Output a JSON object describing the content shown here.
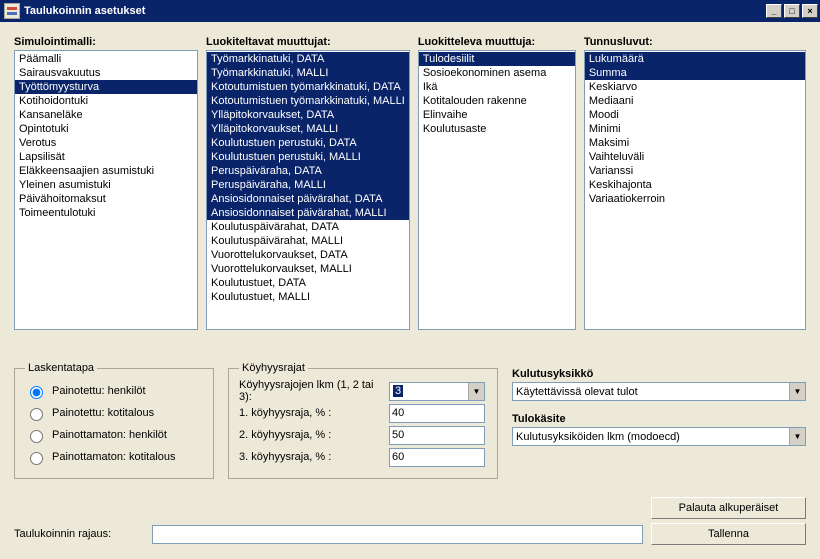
{
  "window": {
    "title": "Taulukoinnin asetukset"
  },
  "columns": {
    "simulointimalli": {
      "label": "Simulointimalli:",
      "items": [
        {
          "label": "Päämalli",
          "sel": false
        },
        {
          "label": "Sairausvakuutus",
          "sel": false
        },
        {
          "label": "Työttömyysturva",
          "sel": true
        },
        {
          "label": "Kotihoidontuki",
          "sel": false
        },
        {
          "label": "Kansaneläke",
          "sel": false
        },
        {
          "label": "Opintotuki",
          "sel": false
        },
        {
          "label": "Verotus",
          "sel": false
        },
        {
          "label": "Lapsilisät",
          "sel": false
        },
        {
          "label": "Eläkkeensaajien asumistuki",
          "sel": false
        },
        {
          "label": "Yleinen asumistuki",
          "sel": false
        },
        {
          "label": "Päivähoitomaksut",
          "sel": false
        },
        {
          "label": "Toimeentulotuki",
          "sel": false
        }
      ]
    },
    "luokiteltavat": {
      "label": "Luokiteltavat muuttujat:",
      "items": [
        {
          "label": "Työmarkkinatuki, DATA",
          "sel": true
        },
        {
          "label": "Työmarkkinatuki, MALLI",
          "sel": true
        },
        {
          "label": "Kotoutumistuen työmarkkinatuki, DATA",
          "sel": true
        },
        {
          "label": "Kotoutumistuen työmarkkinatuki, MALLI",
          "sel": true
        },
        {
          "label": "Ylläpitokorvaukset, DATA",
          "sel": true
        },
        {
          "label": "Ylläpitokorvaukset, MALLI",
          "sel": true
        },
        {
          "label": "Koulutustuen perustuki, DATA",
          "sel": true
        },
        {
          "label": "Koulutustuen perustuki, MALLI",
          "sel": true
        },
        {
          "label": "Peruspäiväraha, DATA",
          "sel": true
        },
        {
          "label": "Peruspäiväraha, MALLI",
          "sel": true
        },
        {
          "label": "Ansiosidonnaiset päivärahat, DATA",
          "sel": true
        },
        {
          "label": "Ansiosidonnaiset päivärahat, MALLI",
          "sel": true
        },
        {
          "label": "Koulutuspäivärahat, DATA",
          "sel": false
        },
        {
          "label": "Koulutuspäivärahat, MALLI",
          "sel": false
        },
        {
          "label": "Vuorottelukorvaukset, DATA",
          "sel": false
        },
        {
          "label": "Vuorottelukorvaukset, MALLI",
          "sel": false
        },
        {
          "label": "Koulutustuet, DATA",
          "sel": false
        },
        {
          "label": "Koulutustuet, MALLI",
          "sel": false
        }
      ]
    },
    "luokitteleva": {
      "label": "Luokitteleva muuttuja:",
      "items": [
        {
          "label": "Tulodesiilit",
          "sel": true
        },
        {
          "label": "Sosioekonominen asema",
          "sel": false
        },
        {
          "label": "Ikä",
          "sel": false
        },
        {
          "label": "Kotitalouden rakenne",
          "sel": false
        },
        {
          "label": "Elinvaihe",
          "sel": false
        },
        {
          "label": "Koulutusaste",
          "sel": false
        }
      ]
    },
    "tunnusluvut": {
      "label": "Tunnusluvut:",
      "items": [
        {
          "label": "Lukumäärä",
          "sel": true
        },
        {
          "label": "Summa",
          "sel": true
        },
        {
          "label": "Keskiarvo",
          "sel": false
        },
        {
          "label": "Mediaani",
          "sel": false
        },
        {
          "label": "Moodi",
          "sel": false
        },
        {
          "label": "Minimi",
          "sel": false
        },
        {
          "label": "Maksimi",
          "sel": false
        },
        {
          "label": "Vaihteluväli",
          "sel": false
        },
        {
          "label": "Varianssi",
          "sel": false
        },
        {
          "label": "Keskihajonta",
          "sel": false
        },
        {
          "label": "Variaatiokerroin",
          "sel": false
        }
      ]
    }
  },
  "laskentatapa": {
    "legend": "Laskentatapa",
    "options": [
      {
        "label": "Painotettu: henkilöt",
        "checked": true
      },
      {
        "label": "Painotettu: kotitalous",
        "checked": false
      },
      {
        "label": "Painottamaton: henkilöt",
        "checked": false
      },
      {
        "label": "Painottamaton: kotitalous",
        "checked": false
      }
    ]
  },
  "koyhyysrajat": {
    "legend": "Köyhyysrajat",
    "count_label": "Köyhyysrajojen lkm (1, 2 tai 3):",
    "count_value": "3",
    "raja1_label": "1. köyhyysraja, % :",
    "raja1_value": "40",
    "raja2_label": "2. köyhyysraja, % :",
    "raja2_value": "50",
    "raja3_label": "3. köyhyysraja, % :",
    "raja3_value": "60"
  },
  "kulutusyksikko": {
    "label": "Kulutusyksikkö",
    "value": "Käytettävissä olevat tulot"
  },
  "tulokasite": {
    "label": "Tulokäsite",
    "value": "Kulutusyksiköiden lkm (modoecd)"
  },
  "footer": {
    "palauta": "Palauta alkuperäiset",
    "tallenna": "Tallenna",
    "rajaus_label": "Taulukoinnin rajaus:",
    "rajaus_value": ""
  }
}
